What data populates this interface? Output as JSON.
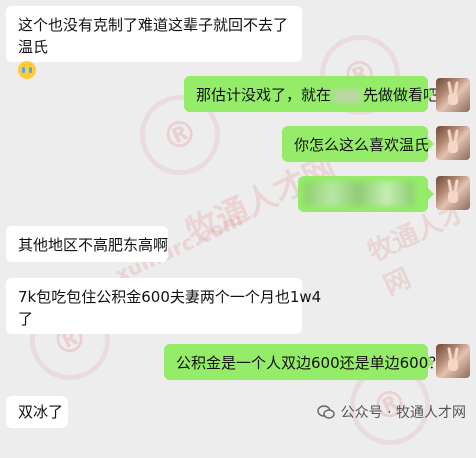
{
  "messages": {
    "m1_text": "这个也没有克制了难道这辈子就回不去了温氏",
    "m2_pre": "那估计没戏了，就在",
    "m2_post": "先做做看吧",
    "m3_text": "你怎么这么喜欢温氏",
    "m5_text": "其他地区不高肥东高啊",
    "m6_line1": "7k包吃包住公积金600夫妻两个一个月也1w4",
    "m6_line2": "了",
    "m7_text": "公积金是一个人双边600还是单边600？",
    "m8_text": "双冰了"
  },
  "footer": {
    "text": "公众号 · 牧通人才网"
  },
  "watermark": {
    "brand": "牧通人才网",
    "url": "xumurc.com",
    "logo_letter": "®"
  },
  "colors": {
    "background": "#ededed",
    "incoming_bubble": "#ffffff",
    "outgoing_bubble": "#95ec69",
    "watermark": "#dc5050"
  }
}
